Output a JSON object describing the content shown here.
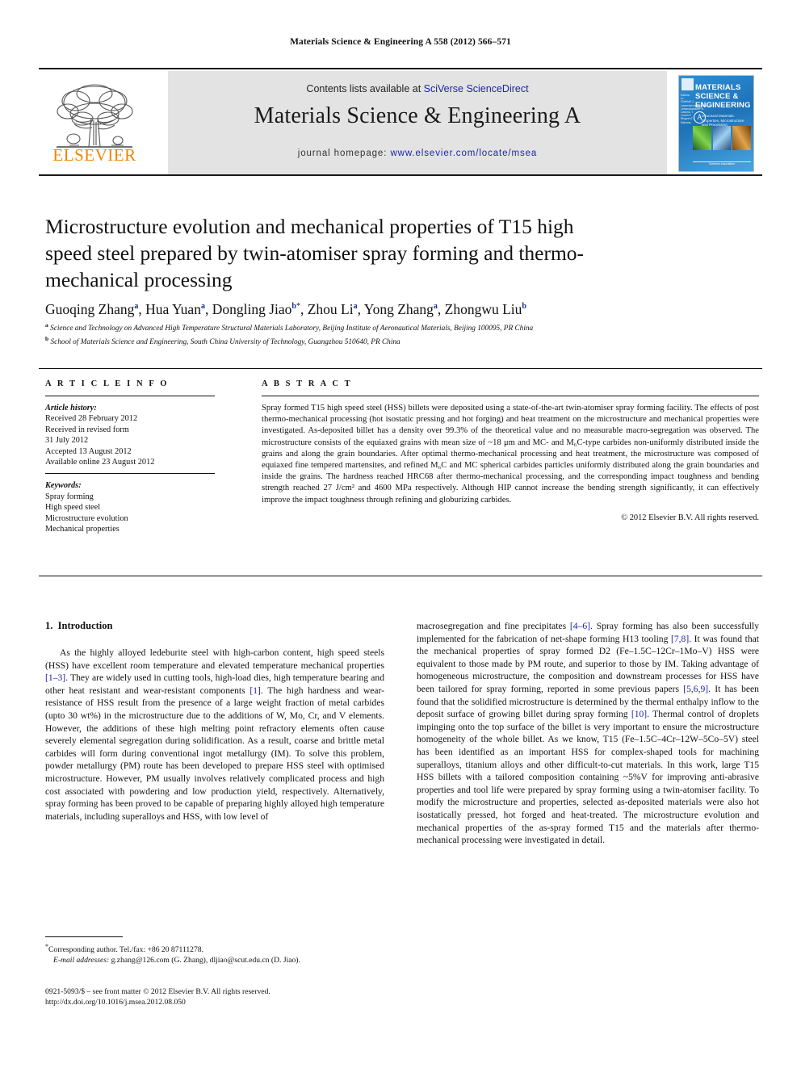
{
  "running_head": "Materials Science & Engineering A 558 (2012) 566–571",
  "masthead": {
    "contents_prefix": "Contents lists available at ",
    "sciencedirect": "SciVerse ScienceDirect",
    "journal_title": "Materials Science & Engineering A",
    "homepage_prefix": "journal homepage: ",
    "homepage_url": "www.elsevier.com/locate/msea",
    "publisher_name": "ELSEVIER",
    "publisher_color": "#F08400",
    "cover": {
      "title_lines": [
        "MATERIALS",
        "SCIENCE &",
        "ENGINEERING"
      ],
      "series_letter": "A",
      "subtitle": "Structural Materials: Properties, Microstructure and Processing",
      "sidebar": "Editors-in-Chief\\nE.J. Lavernia\\n\\nEditors\\nJ.J. Lewandowski\\nP.K. Liaw\\nC.T. Liu\\nS.P. Ringer\\nT. Sakuma",
      "footer": "Sciences Association",
      "background_color": "#1d72b8"
    }
  },
  "article": {
    "title": "Microstructure evolution and mechanical properties of T15 high speed steel prepared by twin-atomiser spray forming and thermo-mechanical processing",
    "authors": [
      {
        "name": "Guoqing Zhang",
        "sup": "a",
        "corresponding": false
      },
      {
        "name": "Hua Yuan",
        "sup": "a",
        "corresponding": false
      },
      {
        "name": "Dongling Jiao",
        "sup": "b",
        "corresponding": true
      },
      {
        "name": "Zhou Li",
        "sup": "a",
        "corresponding": false
      },
      {
        "name": "Yong Zhang",
        "sup": "a",
        "corresponding": false
      },
      {
        "name": "Zhongwu Liu",
        "sup": "b",
        "corresponding": false
      }
    ],
    "affiliations": [
      {
        "marker": "a",
        "text": "Science and Technology on Advanced High Temperature Structural Materials Laboratory, Beijing Institute of Aeronautical Materials, Beijing 100095, PR China"
      },
      {
        "marker": "b",
        "text": "School of Materials Science and Engineering, South China University of Technology, Guangzhou 510640, PR China"
      }
    ]
  },
  "article_info": {
    "heading": "A R T I C L E   I N F O",
    "history_label": "Article history:",
    "history": [
      "Received 28 February 2012",
      "Received in revised form",
      "31 July 2012",
      "Accepted 13 August 2012",
      "Available online 23 August 2012"
    ],
    "keywords_label": "Keywords:",
    "keywords": [
      "Spray forming",
      "High speed steel",
      "Microstructure evolution",
      "Mechanical properties"
    ]
  },
  "abstract": {
    "heading": "A B S T R A C T",
    "text": "Spray formed T15 high speed steel (HSS) billets were deposited using a state-of-the-art twin-atomiser spray forming facility. The effects of post thermo-mechanical processing (hot isostatic pressing and hot forging) and heat treatment on the microstructure and mechanical properties were investigated. As-deposited billet has a density over 99.3% of the theoretical value and no measurable macro-segregation was observed. The microstructure consists of the equiaxed grains with mean size of ~18 μm and MC- and M₆C-type carbides non-uniformly distributed inside the grains and along the grain boundaries. After optimal thermo-mechanical processing and heat treatment, the microstructure was composed of equiaxed fine tempered martensites, and refined M₆C and MC spherical carbides particles uniformly distributed along the grain boundaries and inside the grains. The hardness reached HRC68 after thermo-mechanical processing, and the corresponding impact toughness and bending strength reached 27 J/cm² and 4600 MPa respectively. Although HIP cannot increase the bending strength significantly, it can effectively improve the impact toughness through refining and globurizing carbides.",
    "copyright": "© 2012 Elsevier B.V. All rights reserved."
  },
  "body": {
    "section_number": "1.",
    "section_title": "Introduction",
    "left_paragraph_part1": "As the highly alloyed ledeburite steel with high-carbon content, high speed steels (HSS) have excellent room temperature and elevated temperature mechanical properties ",
    "cite_1_3": "[1–3]",
    "left_paragraph_part2": ". They are widely used in cutting tools, high-load dies, high temperature bearing and other heat resistant and wear-resistant components ",
    "cite_1": "[1]",
    "left_paragraph_part3": ". The high hardness and wear-resistance of HSS result from the presence of a large weight fraction of metal carbides (upto 30 wt%) in the microstructure due to the additions of W, Mo, Cr, and V elements. However, the additions of these high melting point refractory elements often cause severely elemental segregation during solidification. As a result, coarse and brittle metal carbides will form during conventional ingot metallurgy (IM). To solve this problem, powder metallurgy (PM) route has been developed to prepare HSS steel with optimised microstructure. However, PM usually involves relatively complicated process and high cost associated with powdering and low production yield, respectively. Alternatively, spray forming has been proved to be capable of preparing highly alloyed high temperature materials, including superalloys and HSS, with low level of",
    "right_paragraph_part1": "macrosegregation and fine precipitates ",
    "cite_4_6": "[4–6]",
    "right_paragraph_part2": ". Spray forming has also been successfully implemented for the fabrication of net-shape forming H13 tooling ",
    "cite_7_8": "[7,8]",
    "right_paragraph_part3": ". It was found that the mechanical properties of spray formed D2 (Fe–1.5C–12Cr–1Mo–V) HSS were equivalent to those made by PM route, and superior to those by IM. Taking advantage of homogeneous microstructure, the composition and downstream processes for HSS have been tailored for spray forming, reported in some previous papers ",
    "cite_5_6_9": "[5,6,9]",
    "right_paragraph_part4": ". It has been found that the solidified microstructure is determined by the thermal enthalpy inflow to the deposit surface of growing billet during spray forming ",
    "cite_10": "[10]",
    "right_paragraph_part5": ". Thermal control of droplets impinging onto the top surface of the billet is very important to ensure the microstructure homogeneity of the whole billet. As we know, T15 (Fe–1.5C–4Cr–12W–5Co–5V) steel has been identified as an important HSS for complex-shaped tools for machining superalloys, titanium alloys and other difficult-to-cut materials. In this work, large T15 HSS billets with a tailored composition containing ~5%V for improving anti-abrasive properties and tool life were prepared by spray forming using a twin-atomiser facility. To modify the microstructure and properties, selected as-deposited materials were also hot isostatically pressed, hot forged and heat-treated. The microstructure evolution and mechanical properties of the as-spray formed T15 and the materials after thermo-mechanical processing were investigated in detail."
  },
  "footnote": {
    "corresponding_marker": "*",
    "corresponding": "Corresponding author. Tel./fax: +86 20 87111278.",
    "email_label": "E-mail addresses:",
    "emails": "g.zhang@126.com (G. Zhang), dljiao@scut.edu.cn (D. Jiao)."
  },
  "imprint": {
    "issn_line": "0921-5093/$ – see front matter © 2012 Elsevier B.V. All rights reserved.",
    "doi_line": "http://dx.doi.org/10.1016/j.msea.2012.08.050"
  },
  "colors": {
    "link_blue": "#1c24a8",
    "elsevier_orange": "#F08400",
    "masthead_gray": "#e3e3e3"
  }
}
